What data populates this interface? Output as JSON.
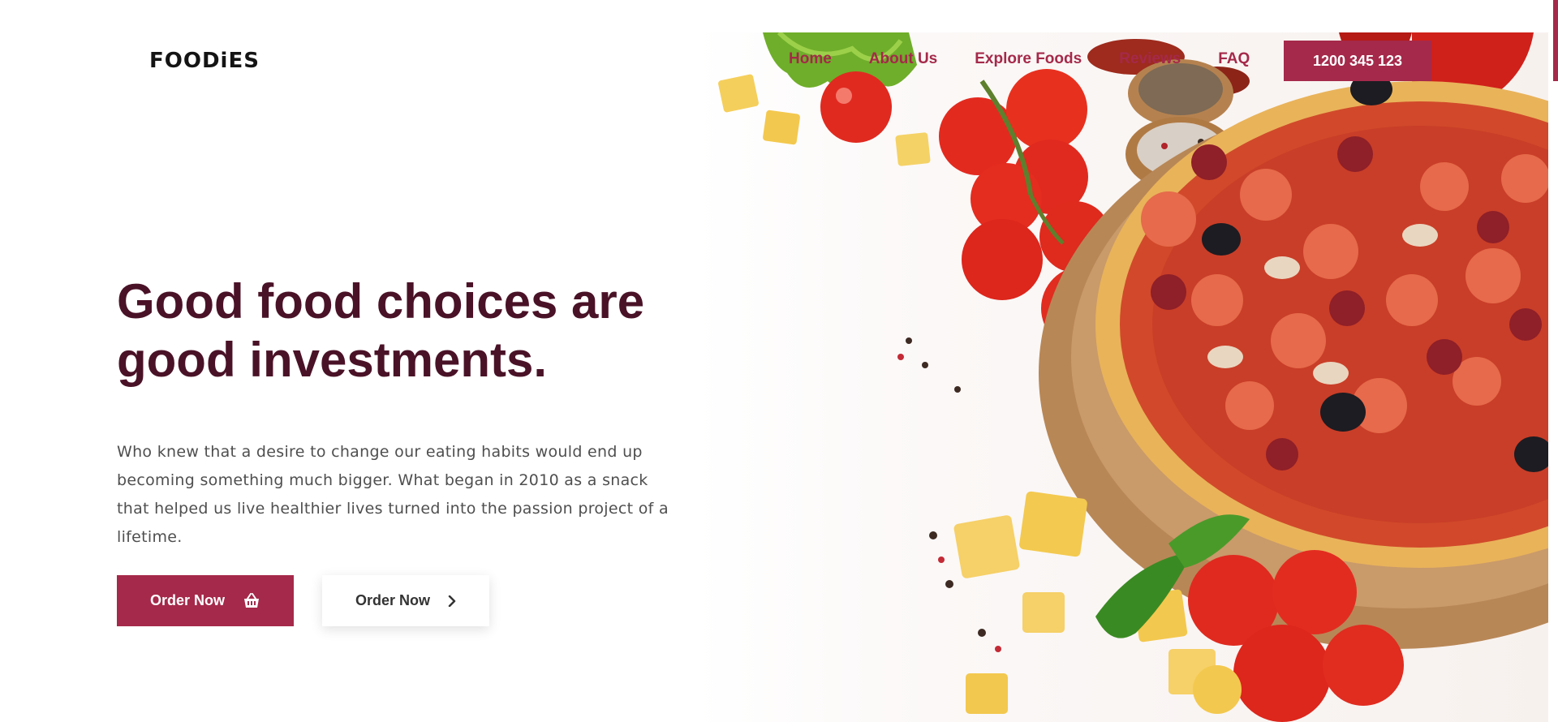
{
  "brand": {
    "logo_text": "FOODiES"
  },
  "nav": {
    "items": [
      "Home",
      "About Us",
      "Explore Foods",
      "Reviews",
      "FAQ"
    ],
    "phone_button_label": "1200 345 123"
  },
  "hero": {
    "headline": "Good food choices are good investments.",
    "description": "Who knew that a desire to change our eating habits would end up becoming something much bigger. What began in 2010 as a snack that helped us live healthier lives turned into the passion project of a lifetime.",
    "primary_button_label": "Order Now",
    "secondary_button_label": "Order Now",
    "primary_icon": "basket-icon",
    "secondary_icon": "chevron-right-icon"
  },
  "colors": {
    "brand": "#a5294a",
    "headline": "#4a1227",
    "body_text": "#4f4f4f"
  }
}
